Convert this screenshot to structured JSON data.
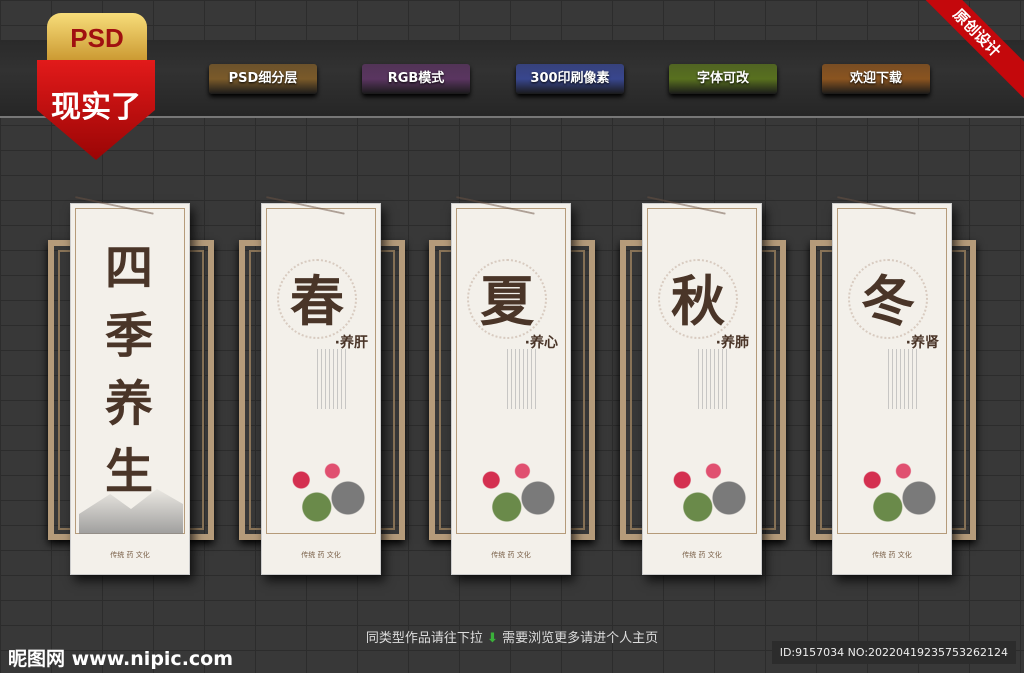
{
  "badge": {
    "top": "PSD",
    "bottom": "现实了"
  },
  "corner_ribbon": "原创设计",
  "features": [
    {
      "label": "PSD细分层",
      "color": "#7a5a2a"
    },
    {
      "label": "RGB模式",
      "color": "#5a3560"
    },
    {
      "label": "300印刷像素",
      "color": "#38468e"
    },
    {
      "label": "字体可改",
      "color": "#58701f"
    },
    {
      "label": "欢迎下载",
      "color": "#8a5420"
    }
  ],
  "panels": [
    {
      "title": "四季养生",
      "footer": "传统 药 文化"
    },
    {
      "char": "春",
      "sub": "·养肝",
      "footer": "传统 药 文化"
    },
    {
      "char": "夏",
      "sub": "·养心",
      "footer": "传统 药 文化"
    },
    {
      "char": "秋",
      "sub": "·养肺",
      "footer": "传统 药 文化"
    },
    {
      "char": "冬",
      "sub": "·养肾",
      "footer": "传统 药 文化"
    }
  ],
  "bottom": {
    "left_text": "同类型作品请往下拉",
    "arrow": "⬇",
    "right_text": "需要浏览更多请进个人主页"
  },
  "watermark": "昵图网 www.nipic.com",
  "image_id": "ID:9157034 NO:20220419235753262124"
}
